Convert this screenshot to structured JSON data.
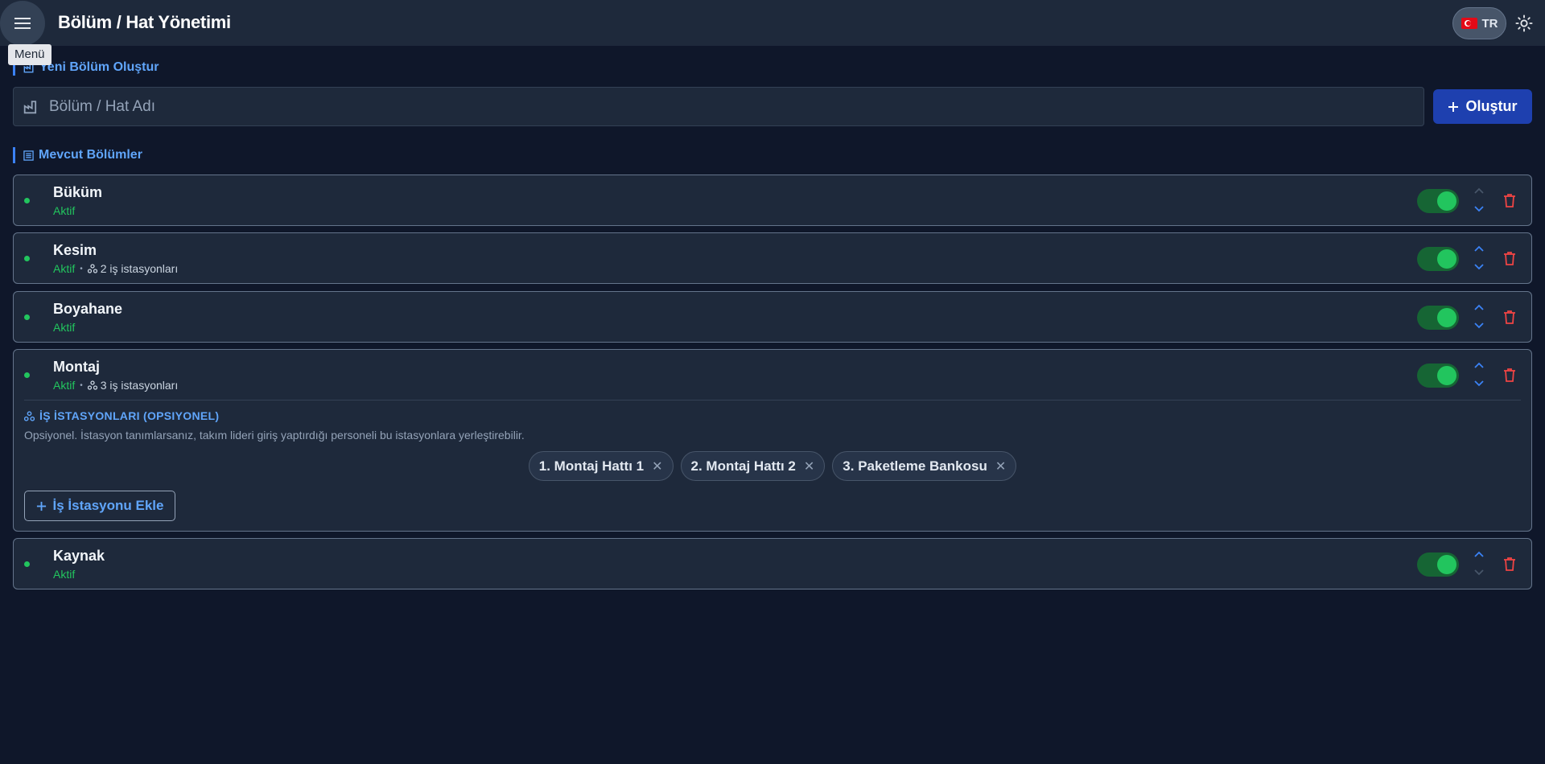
{
  "header": {
    "title": "Bölüm / Hat Yönetimi",
    "menu_tooltip": "Menü",
    "language": "TR"
  },
  "create_section": {
    "title": "Yeni Bölüm Oluştur",
    "input_placeholder": "Bölüm / Hat Adı",
    "input_value": "",
    "create_button": "Oluştur"
  },
  "list_section": {
    "title": "Mevcut Bölümler"
  },
  "departments": [
    {
      "name": "Büküm",
      "status": "Aktif",
      "workstations_text": "",
      "active": true,
      "can_move_up": false,
      "can_move_down": true
    },
    {
      "name": "Kesim",
      "status": "Aktif",
      "workstations_text": "2 iş istasyonları",
      "active": true,
      "can_move_up": true,
      "can_move_down": true
    },
    {
      "name": "Boyahane",
      "status": "Aktif",
      "workstations_text": "",
      "active": true,
      "can_move_up": true,
      "can_move_down": true
    },
    {
      "name": "Montaj",
      "status": "Aktif",
      "workstations_text": "3 iş istasyonları",
      "active": true,
      "can_move_up": true,
      "can_move_down": true,
      "expanded": true
    },
    {
      "name": "Kaynak",
      "status": "Aktif",
      "workstations_text": "",
      "active": true,
      "can_move_up": true,
      "can_move_down": false
    }
  ],
  "workstations_panel": {
    "title": "İŞ İSTASYONLARI (OPSIYONEL)",
    "description": "Opsiyonel. İstasyon tanımlarsanız, takım lideri giriş yaptırdığı personeli bu istasyonlara yerleştirebilir.",
    "items": [
      "1. Montaj Hattı 1",
      "2. Montaj Hattı 2",
      "3. Paketleme Bankosu"
    ],
    "add_button": "İş İstasyonu Ekle"
  },
  "colors": {
    "background": "#0f172a",
    "surface": "#1e293b",
    "accent": "#60a5fa",
    "primary_button": "#1e40af",
    "success": "#22c55e",
    "danger": "#ef4444"
  },
  "icons": [
    "menu-icon",
    "sun-icon",
    "factory-icon",
    "list-icon",
    "plus-icon",
    "workstation-icon",
    "chevron-up-icon",
    "chevron-down-icon",
    "trash-icon",
    "close-icon"
  ]
}
